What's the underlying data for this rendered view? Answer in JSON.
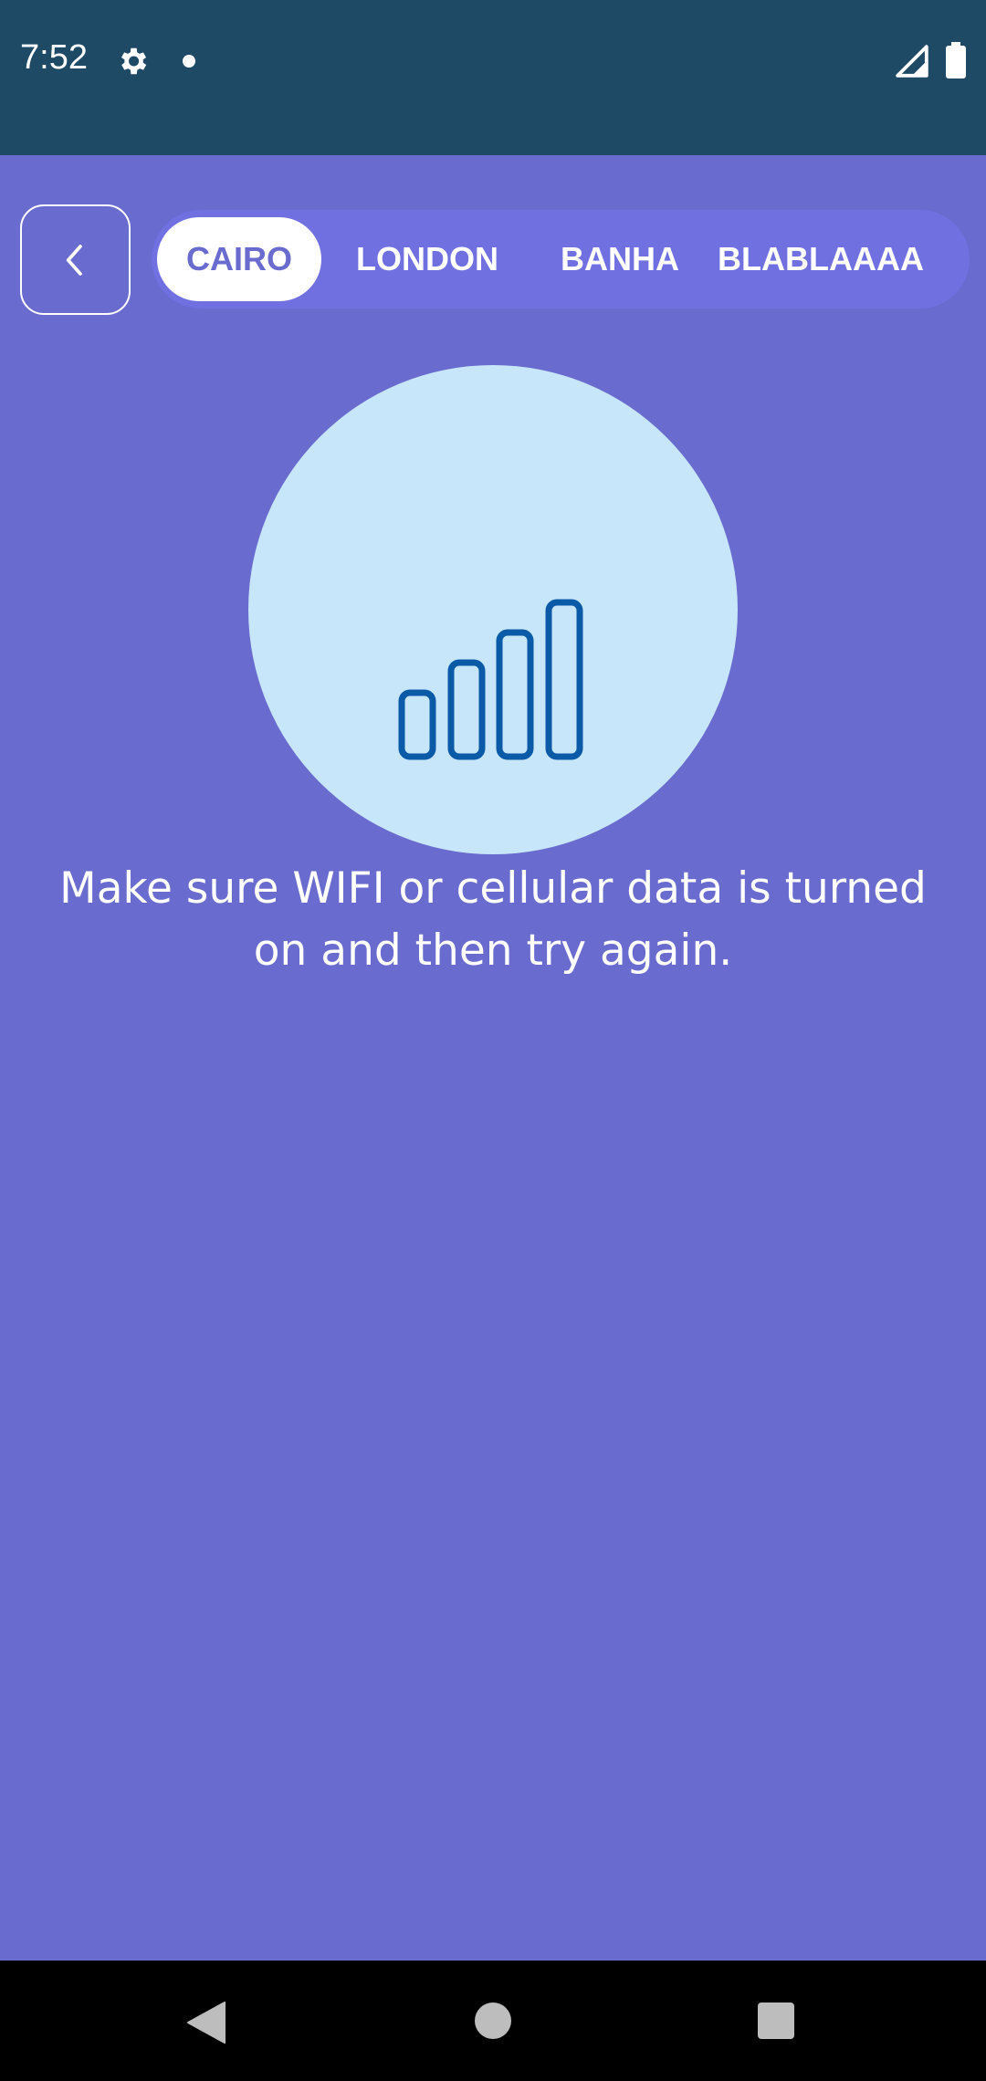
{
  "status_bar": {
    "time": "7:52",
    "icons": [
      "gear-icon",
      "notification-dot-icon",
      "cell-signal-icon",
      "battery-icon"
    ]
  },
  "header": {
    "back_icon": "chevron-left-icon",
    "tabs": [
      {
        "label": "CAIRO",
        "selected": true
      },
      {
        "label": "LONDON",
        "selected": false
      },
      {
        "label": "BANHA",
        "selected": false
      },
      {
        "label": "BLABLAAAA",
        "selected": false
      }
    ]
  },
  "error": {
    "icon": "signal-bars-icon",
    "message": "Make sure WIFI or cellular data is turned on and then try again."
  },
  "nav_bar": {
    "icons": [
      "nav-back-icon",
      "nav-home-icon",
      "nav-recents-icon"
    ]
  },
  "colors": {
    "background": "#6a6bce",
    "status_bar": "#1e4a66",
    "tab_track": "#7070e0",
    "circle": "#c8e6fa",
    "icon_stroke": "#0a5aa8"
  }
}
